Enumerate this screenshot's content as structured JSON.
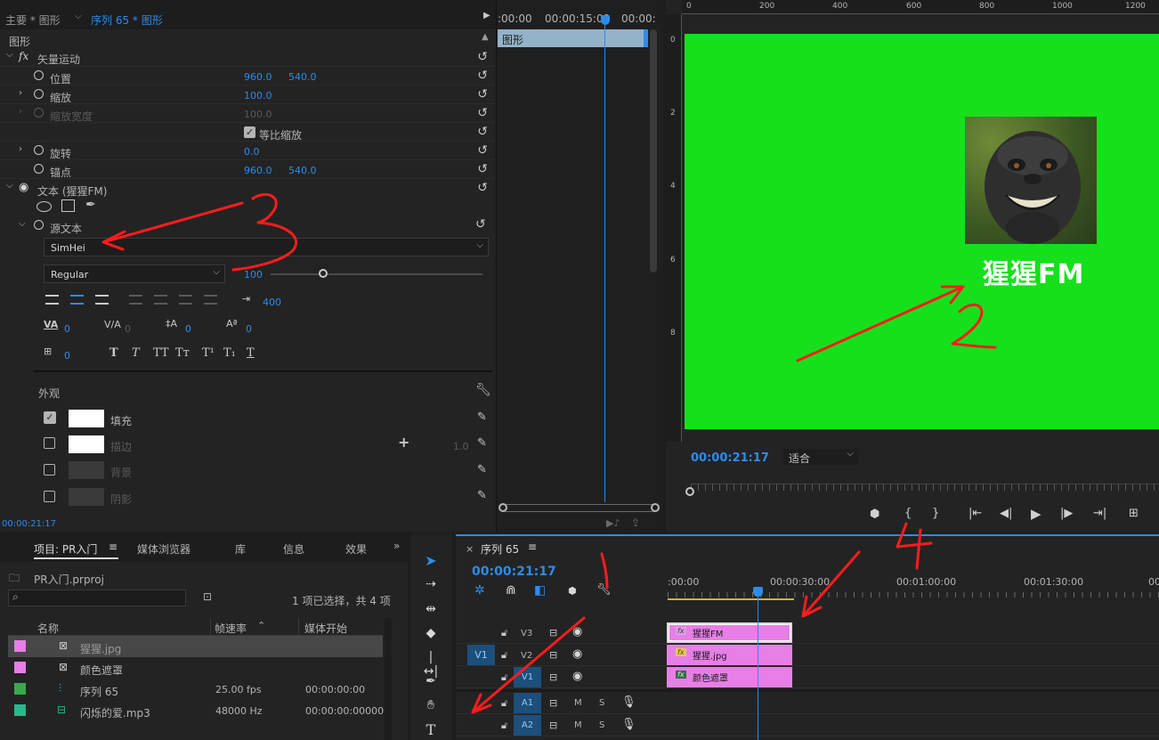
{
  "effects_panel": {
    "tab_main": "主要 * 图形",
    "tab_seq": "序列 65 * 图形",
    "mini_tl": {
      "t0": ":00:00",
      "t1": "00:00:15:00",
      "t2": "00:00:"
    },
    "clip_label": "图形",
    "section": "图形",
    "vector_motion": "矢量运动",
    "position_label": "位置",
    "position_x": "960.0",
    "position_y": "540.0",
    "scale_label": "缩放",
    "scale_val": "100.0",
    "scale_width_label": "缩放宽度",
    "scale_width_val": "100.0",
    "uniform_scale": "等比缩放",
    "rotation_label": "旋转",
    "rotation_val": "0.0",
    "anchor_label": "锚点",
    "anchor_x": "960.0",
    "anchor_y": "540.0",
    "text_layer": "文本 (猩猩FM)",
    "source_text": "源文本",
    "font_family": "SimHei",
    "font_style": "Regular",
    "font_size": "100",
    "tracking_right": "400",
    "kerning": "0",
    "tracking": "0",
    "leading": "0",
    "baseline": "0",
    "tsume": "0",
    "appearance": "外观",
    "fill": "填充",
    "stroke": "描边",
    "stroke_width": "1.0",
    "background": "背景",
    "shadow": "阴影",
    "timecode": "00:00:21:17"
  },
  "program_monitor": {
    "ruler": [
      "0",
      "200",
      "400",
      "600",
      "800",
      "1000",
      "1200"
    ],
    "vruler": [
      "0",
      "2",
      "4",
      "6",
      "8"
    ],
    "title_text": "猩猩FM",
    "timecode": "00:00:21:17",
    "fit": "适合",
    "green": "#15e01b"
  },
  "project_panel": {
    "tabs": [
      "项目: PR入门",
      "媒体浏览器",
      "库",
      "信息",
      "效果"
    ],
    "project_file": "PR入门.prproj",
    "selection_info": "1 项已选择，共 4 项",
    "columns": [
      "名称",
      "帧速率",
      "媒体开始"
    ],
    "items": [
      {
        "name": "猩猩.jpg",
        "fps": "",
        "start": "",
        "color": "#e77fe6"
      },
      {
        "name": "颜色遮罩",
        "fps": "",
        "start": "",
        "color": "#e77fe6"
      },
      {
        "name": "序列 65",
        "fps": "25.00 fps",
        "start": "00:00:00:00",
        "color": "#3ba84f"
      },
      {
        "name": "闪烁的爱.mp3",
        "fps": "48000 Hz",
        "start": "00:00:00:00000",
        "color": "#25b98c"
      }
    ]
  },
  "timeline": {
    "tab": "序列 65",
    "timecode": "00:00:21:17",
    "ruler": [
      ":00:00",
      "00:00:30:00",
      "00:01:00:00",
      "00:01:30:00",
      "00"
    ],
    "tracks": [
      "V3",
      "V2",
      "V1",
      "A1",
      "A2"
    ],
    "source_patch": "V1",
    "clips": [
      {
        "label": "猩猩FM",
        "track": "V3"
      },
      {
        "label": "猩猩.jpg",
        "track": "V2"
      },
      {
        "label": "颜色遮罩",
        "track": "V1"
      }
    ],
    "m": "M",
    "s": "S"
  }
}
